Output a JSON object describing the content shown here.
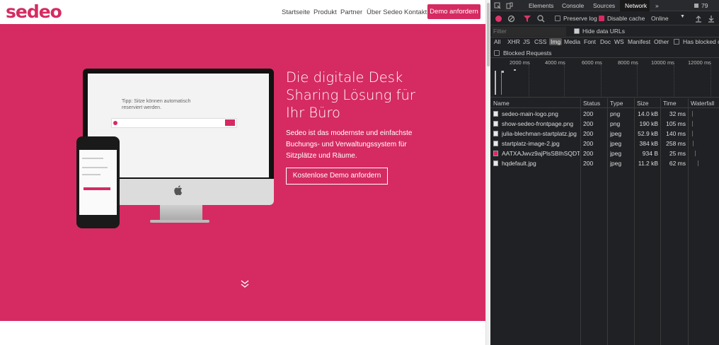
{
  "site": {
    "logo": "sedeo",
    "nav": {
      "links": [
        "Startseite",
        "Produkt",
        "Partner",
        "Über Sedeo",
        "Kontakt"
      ],
      "cta": "Demo anfordern"
    },
    "hero": {
      "title": "Die digitale Desk Sharing Lösung für Ihr Büro",
      "text": "Sedeo ist das modernste und einfachste Buchungs- und Verwaltungssystem für Sitzplätze und Räume.",
      "cta": "Kostenlose Demo anfordern",
      "screen_tip": "Tipp: Sitze können automatisch reserviert werden."
    },
    "colors": {
      "brand": "#d52b62"
    }
  },
  "devtools": {
    "tabs": [
      "Elements",
      "Console",
      "Sources",
      "Network"
    ],
    "active_tab": "Network",
    "more_tabs": "»",
    "issues_count": "79",
    "toolbar": {
      "preserve_log": "Preserve log",
      "preserve_log_checked": false,
      "disable_cache": "Disable cache",
      "disable_cache_checked": true,
      "throttling": "Online"
    },
    "filter": {
      "placeholder": "Filter",
      "hide_data_urls": "Hide data URLs",
      "hide_data_urls_checked": true,
      "types": [
        "All",
        "XHR",
        "JS",
        "CSS",
        "Img",
        "Media",
        "Font",
        "Doc",
        "WS",
        "Manifest",
        "Other"
      ],
      "active_type": "Img",
      "has_blocked": "Has blocked c",
      "blocked_requests": "Blocked Requests"
    },
    "timeline_ticks": [
      "2000 ms",
      "4000 ms",
      "6000 ms",
      "8000 ms",
      "10000 ms",
      "12000 ms"
    ],
    "columns": [
      "Name",
      "Status",
      "Type",
      "Size",
      "Time",
      "Waterfall"
    ],
    "requests": [
      {
        "name": "sedeo-main-logo.png",
        "status": "200",
        "type": "png",
        "size": "14.0 kB",
        "time": "32 ms"
      },
      {
        "name": "show-sedeo-frontpage.png",
        "status": "200",
        "type": "png",
        "size": "190 kB",
        "time": "105 ms"
      },
      {
        "name": "julia-blechman-startplatz.jpg",
        "status": "200",
        "type": "jpeg",
        "size": "52.9 kB",
        "time": "140 ms"
      },
      {
        "name": "startplatz-image-2.jpg",
        "status": "200",
        "type": "jpeg",
        "size": "384 kB",
        "time": "258 ms"
      },
      {
        "name": "AATXAJwvz9ajPlsSBIhSQDT...",
        "status": "200",
        "type": "jpeg",
        "size": "934 B",
        "time": "25 ms"
      },
      {
        "name": "hqdefault.jpg",
        "status": "200",
        "type": "jpeg",
        "size": "11.2 kB",
        "time": "62 ms"
      }
    ]
  }
}
